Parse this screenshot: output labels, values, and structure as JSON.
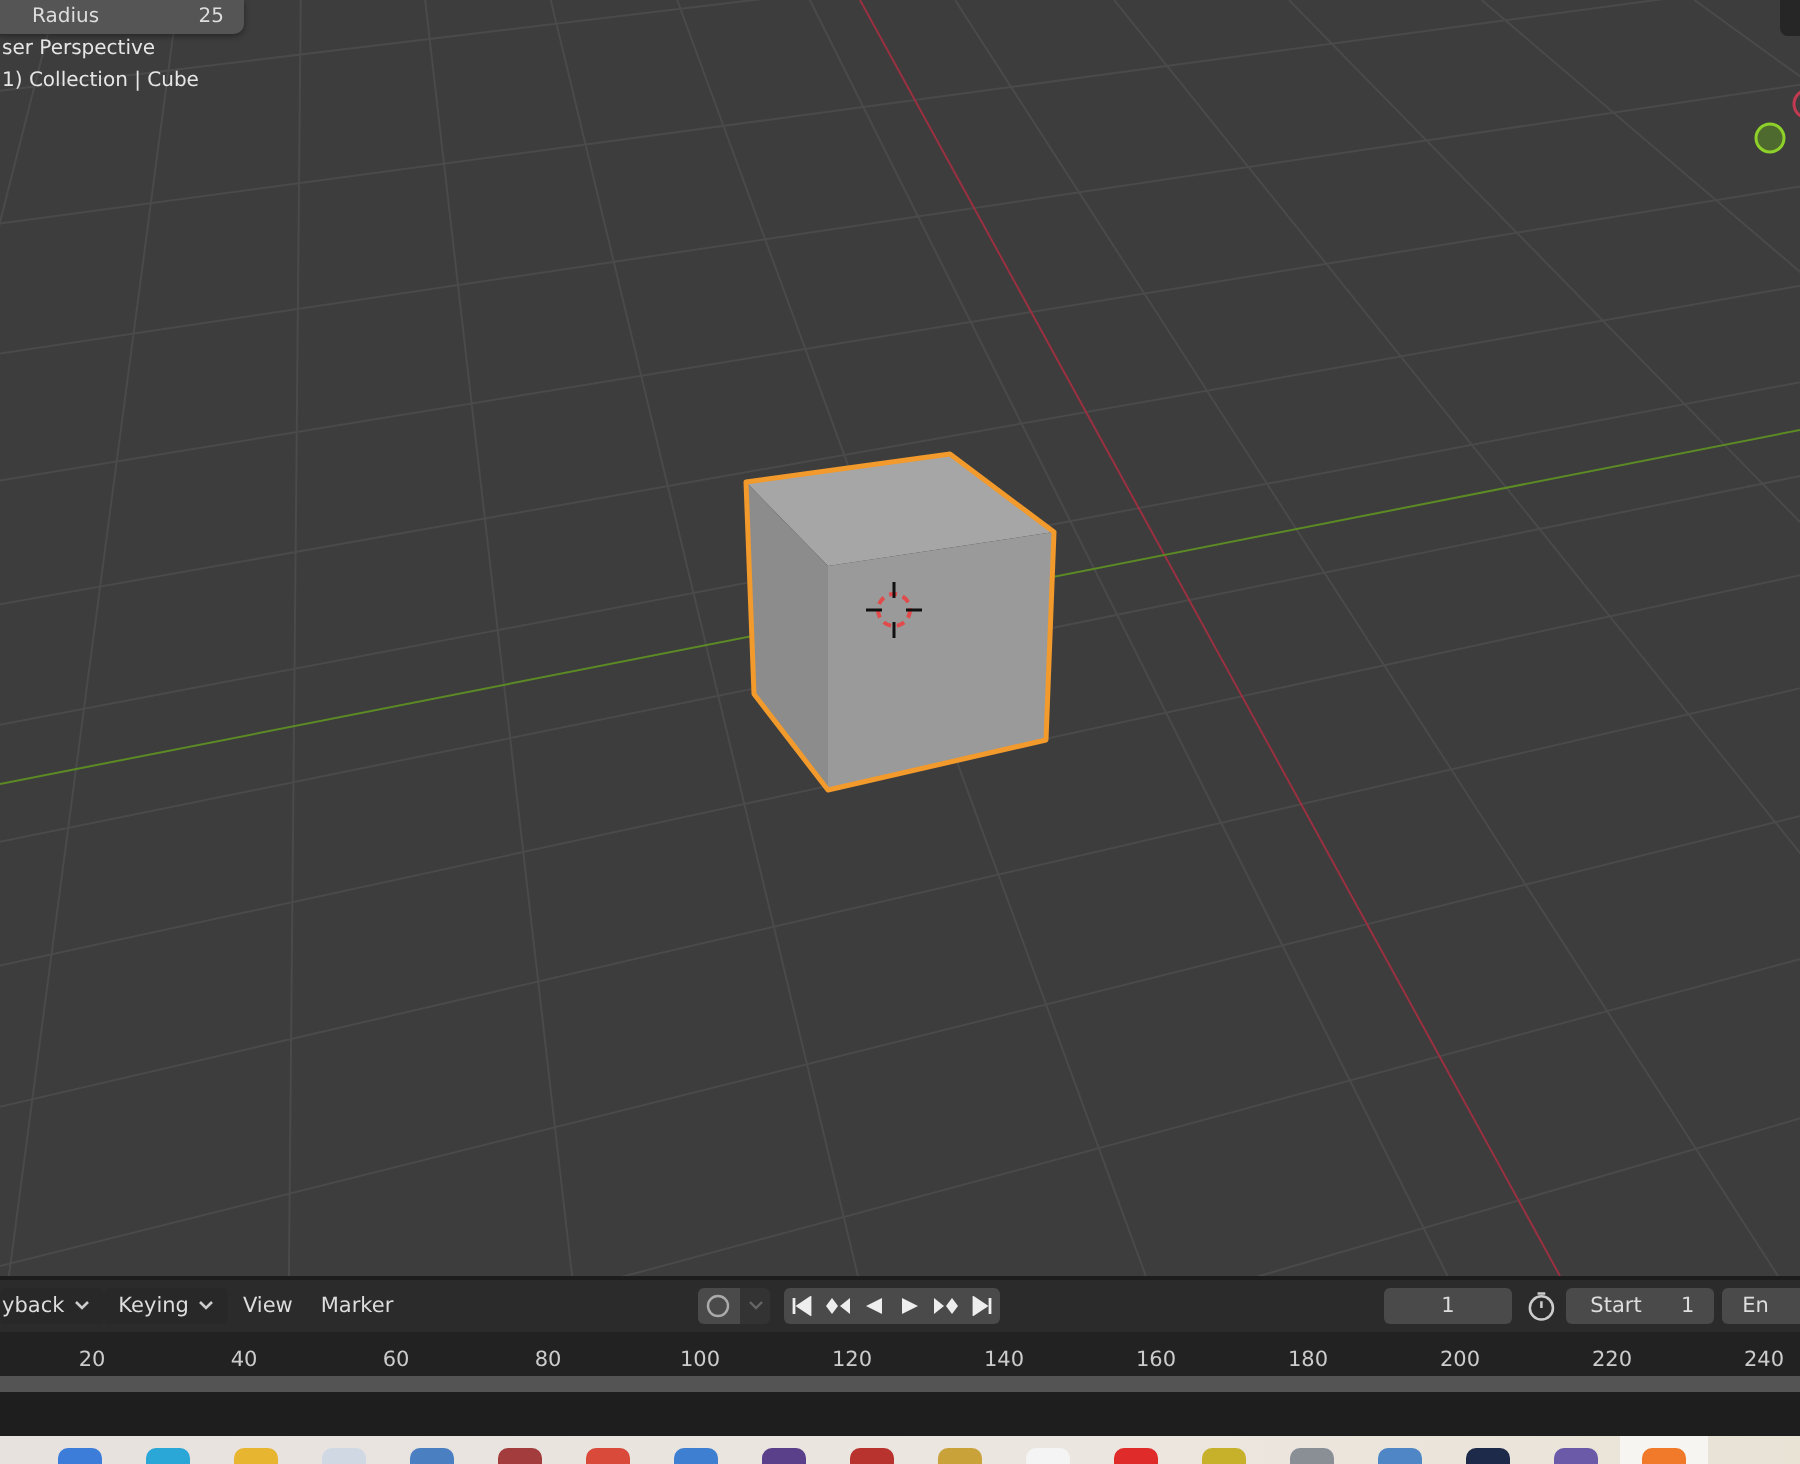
{
  "viewport": {
    "redo_panel": {
      "label": "Radius",
      "value": "25"
    },
    "view_name": "ser Perspective",
    "collection_info": "1) Collection | Cube"
  },
  "timeline": {
    "menus": [
      {
        "label": "yback",
        "kind": "dropdown"
      },
      {
        "label": "Keying",
        "kind": "dropdown"
      },
      {
        "label": "View",
        "kind": "plain"
      },
      {
        "label": "Marker",
        "kind": "plain"
      }
    ],
    "current_frame": "1",
    "start": {
      "label": "Start",
      "value": "1"
    },
    "end_label": "En",
    "ruler_labels": [
      "20",
      "40",
      "60",
      "80",
      "100",
      "120",
      "140",
      "160",
      "180",
      "200",
      "220",
      "240"
    ]
  }
}
